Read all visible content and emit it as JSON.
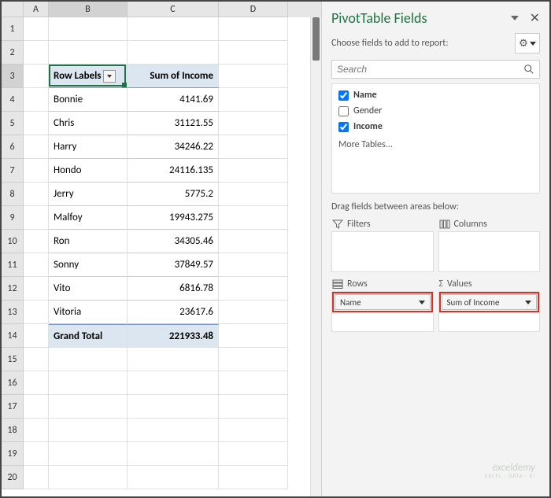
{
  "columns": [
    "A",
    "B",
    "C",
    "D"
  ],
  "row_count": 20,
  "active": {
    "col": "B",
    "row": 3
  },
  "pivot": {
    "header_left": "Row Labels",
    "header_right": "Sum of Income",
    "rows": [
      {
        "label": "Bonnie",
        "value": "4141.69"
      },
      {
        "label": "Chris",
        "value": "31121.55"
      },
      {
        "label": "Harry",
        "value": "34246.22"
      },
      {
        "label": "Hondo",
        "value": "24116.135"
      },
      {
        "label": "Jerry",
        "value": "5775.2"
      },
      {
        "label": "Malfoy",
        "value": "19943.275"
      },
      {
        "label": "Ron",
        "value": "34305.46"
      },
      {
        "label": "Sonny",
        "value": "37849.57"
      },
      {
        "label": "Vito",
        "value": "6816.78"
      },
      {
        "label": "Vitoria",
        "value": "23617.6"
      }
    ],
    "total_label": "Grand Total",
    "total_value": "221933.48"
  },
  "pane": {
    "title": "PivotTable Fields",
    "choose_label": "Choose fields to add to report:",
    "search_placeholder": "Search",
    "fields": [
      {
        "name": "Name",
        "checked": true
      },
      {
        "name": "Gender",
        "checked": false
      },
      {
        "name": "Income",
        "checked": true
      }
    ],
    "more_tables": "More Tables...",
    "drag_label": "Drag fields between areas below:",
    "areas": {
      "filters": {
        "label": "Filters",
        "items": []
      },
      "columns": {
        "label": "Columns",
        "items": []
      },
      "rows": {
        "label": "Rows",
        "items": [
          "Name"
        ]
      },
      "values": {
        "label": "Values",
        "items": [
          "Sum of Income"
        ]
      }
    }
  },
  "watermark": {
    "name": "exceldemy",
    "tag": "EXCEL · DATA · BI"
  }
}
